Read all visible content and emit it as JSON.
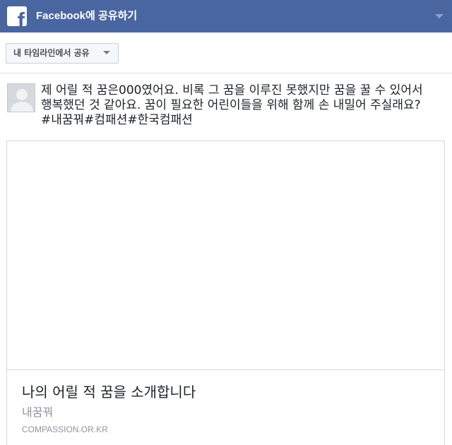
{
  "header": {
    "logo_letter": "f",
    "logo_icon": "facebook-logo-icon",
    "title": "Facebook에 공유하기",
    "menu_icon": "chevron-down-icon"
  },
  "share_target": {
    "label": "내 타임라인에서 공유",
    "icon": "caret-down-icon"
  },
  "post": {
    "avatar_icon": "default-avatar-icon",
    "message_lines": [
      "제 어릴 적 꿈은000였어요. 비록 그 꿈을 이루진 못했지만 꿈을 꿀 수 있어서",
      "행복했던 것 같아요. 꿈이 필요한 어린이들을 위해 함께 손 내밀어 주실래요?",
      "#내꿈꿔#컴패션#한국컴패션"
    ]
  },
  "link_preview": {
    "title": "나의 어릴 적 꿈을 소개합니다",
    "description": "내꿈꿔",
    "domain": "COMPASSION.OR.KR"
  },
  "colors": {
    "header_bg": "#4a66a0",
    "header_text": "#ffffff",
    "text": "#1d2129",
    "muted": "#90949c",
    "border": "#d3d6db"
  }
}
